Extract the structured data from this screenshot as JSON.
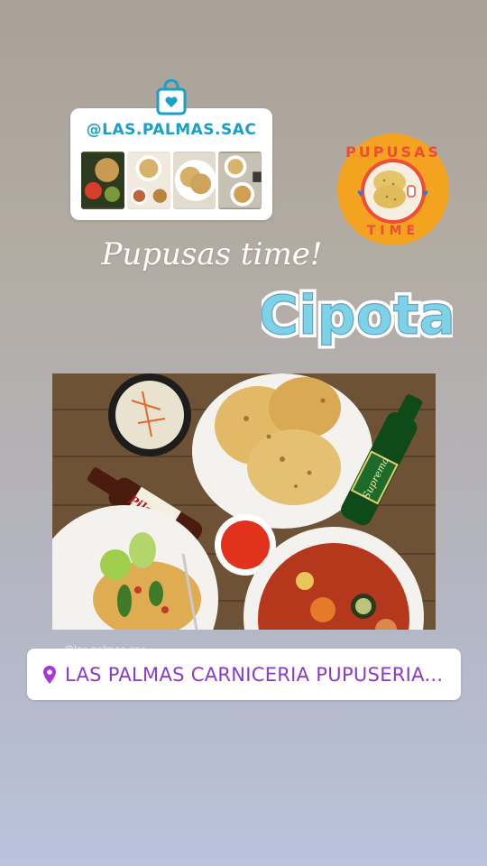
{
  "shop_sticker": {
    "handle": "@LAS.PALMAS.SAC",
    "icon": "shopping-bag-icon",
    "accent": "#1aa0c8"
  },
  "logo": {
    "text": "PUPUSAS TIME",
    "bg": "#f4a321"
  },
  "title": "Pupusas time!",
  "sticker_word": "Cipota",
  "watermark": "@las.palmas.sac",
  "location": {
    "icon": "location-pin-icon",
    "label": "LAS PALMAS CARNICERIA PUPUSERIA...",
    "color": "#8b3ac4"
  },
  "photo": {
    "bottle_left_label": "Pilsener",
    "bottle_right_label": "Suprema"
  }
}
